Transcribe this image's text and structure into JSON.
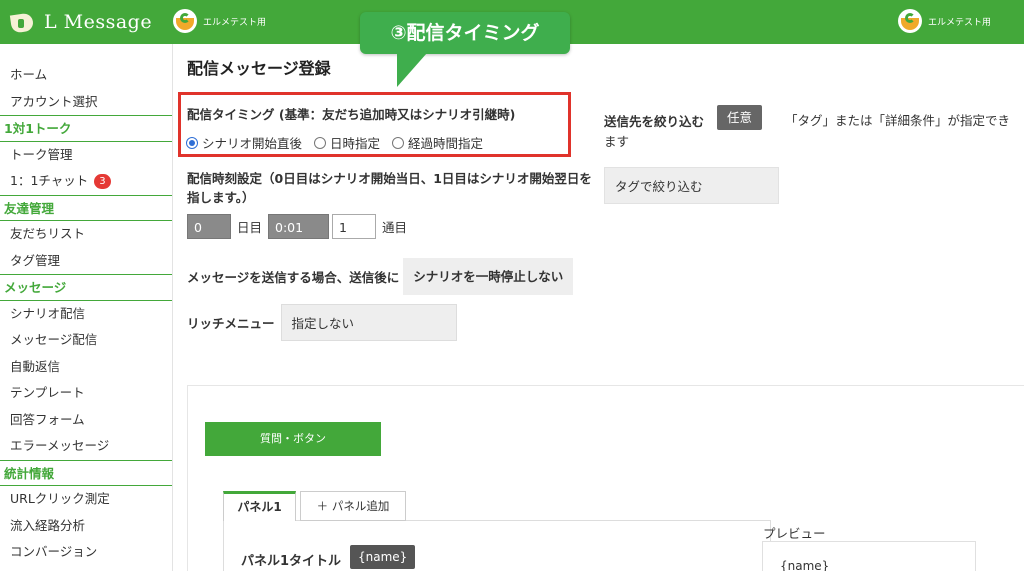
{
  "app": {
    "name": "L Message"
  },
  "header": {
    "account_left": "エルメテスト用",
    "account_right": "エルメテスト用"
  },
  "callout": {
    "text": "③配信タイミング"
  },
  "sidebar": {
    "items": [
      {
        "type": "item",
        "label": "ホーム"
      },
      {
        "type": "item",
        "label": "アカウント選択"
      },
      {
        "type": "section",
        "label": "1対1トーク"
      },
      {
        "type": "item",
        "label": "トーク管理"
      },
      {
        "type": "item",
        "label": "1：1チャット",
        "badge": "3"
      },
      {
        "type": "section",
        "label": "友達管理"
      },
      {
        "type": "item",
        "label": "友だちリスト"
      },
      {
        "type": "item",
        "label": "タグ管理"
      },
      {
        "type": "section",
        "label": "メッセージ"
      },
      {
        "type": "item",
        "label": "シナリオ配信"
      },
      {
        "type": "item",
        "label": "メッセージ配信"
      },
      {
        "type": "item",
        "label": "自動返信"
      },
      {
        "type": "item",
        "label": "テンプレート"
      },
      {
        "type": "item",
        "label": "回答フォーム"
      },
      {
        "type": "item",
        "label": "エラーメッセージ"
      },
      {
        "type": "section",
        "label": "統計情報"
      },
      {
        "type": "item",
        "label": "URLクリック測定"
      },
      {
        "type": "item",
        "label": "流入経路分析"
      },
      {
        "type": "item",
        "label": "コンバージョン"
      }
    ]
  },
  "main": {
    "title": "配信メッセージ登録",
    "timing": {
      "label": "配信タイミング (基準：友だち追加時又はシナリオ引継時)",
      "options": [
        {
          "label": "シナリオ開始直後",
          "selected": true
        },
        {
          "label": "日時指定",
          "selected": false
        },
        {
          "label": "経過時間指定",
          "selected": false
        }
      ]
    },
    "time_setting": {
      "label": "配信時刻設定（0日目はシナリオ開始当日、1日目はシナリオ開始翌日を指します。）",
      "day_value": "0",
      "day_unit": "日目",
      "time_value": "0:01",
      "count_value": "1",
      "count_unit": "通目"
    },
    "send": {
      "label": "メッセージを送信する場合、送信後に",
      "button": "シナリオを一時停止しない"
    },
    "rich_menu": {
      "label": "リッチメニュー",
      "value": "指定しない"
    },
    "filter": {
      "label": "送信先を絞り込む",
      "option": "任意",
      "note_line1": "「タグ」または「詳細条件」が指定でき",
      "note_line2": "ます",
      "tag_button": "タグで絞り込む"
    },
    "editor": {
      "question_button": "質問・ボタン",
      "tab_panel": "パネル1",
      "tab_add": "＋ パネル追加",
      "panel_title_label": "パネル1タイトル",
      "name_chip": "{name}",
      "preview_label": "プレビュー",
      "preview_name": "{name}"
    }
  },
  "colors": {
    "brand_green": "#43a83a",
    "callout_green": "#3fae4d",
    "highlight_red": "#e0332b",
    "badge_red": "#e53935"
  }
}
